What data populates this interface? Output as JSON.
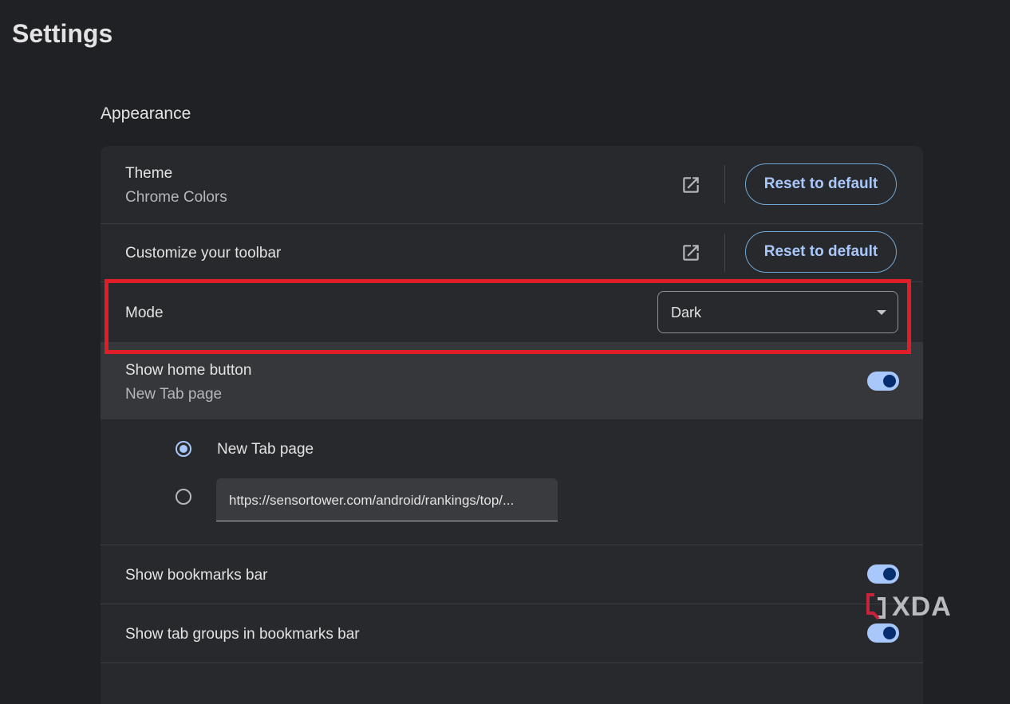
{
  "page": {
    "title": "Settings"
  },
  "appearance": {
    "section_title": "Appearance",
    "theme": {
      "label": "Theme",
      "value": "Chrome Colors",
      "reset_label": "Reset to default",
      "external_icon": "open-in-new-icon"
    },
    "toolbar": {
      "label": "Customize your toolbar",
      "reset_label": "Reset to default",
      "external_icon": "open-in-new-icon"
    },
    "mode": {
      "label": "Mode",
      "selected": "Dark"
    },
    "home_button": {
      "label": "Show home button",
      "sublabel": "New Tab page",
      "enabled": true,
      "options": [
        {
          "label": "New Tab page",
          "selected": true
        },
        {
          "url_value": "https://sensortower.com/android/rankings/top/...",
          "selected": false
        }
      ]
    },
    "bookmarks_bar": {
      "label": "Show bookmarks bar",
      "enabled": true
    },
    "tab_groups": {
      "label": "Show tab groups in bookmarks bar",
      "enabled": true
    }
  },
  "colors": {
    "accent": "#a8c7fa",
    "highlight": "#e01e27",
    "background": "#202124",
    "card": "#28292c"
  },
  "watermark": {
    "text": "XDA"
  }
}
